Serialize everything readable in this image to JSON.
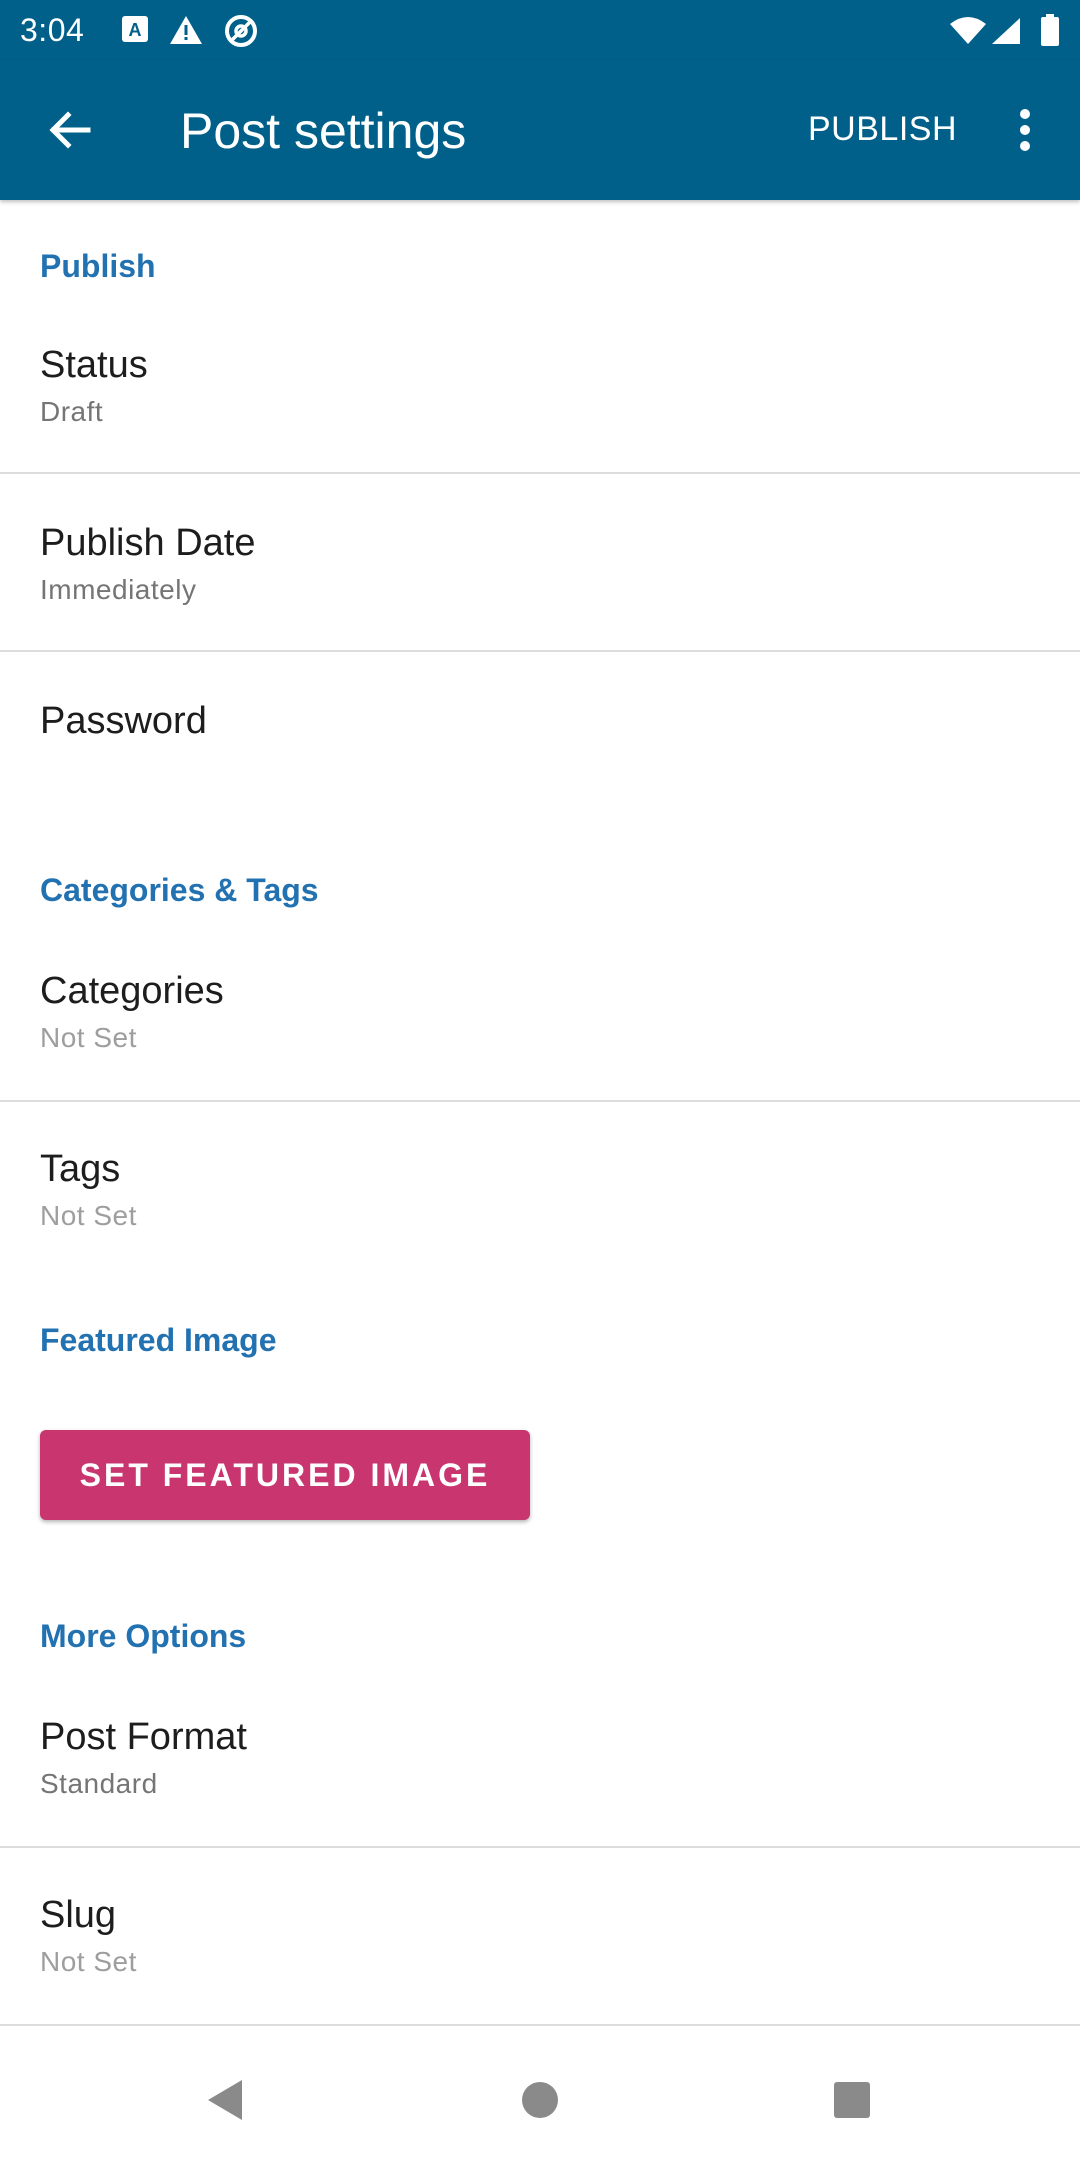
{
  "status_bar": {
    "time": "3:04",
    "icons": [
      "keyboard-a-icon",
      "warning-icon",
      "at-sign-icon",
      "wifi-icon",
      "signal-icon",
      "battery-icon"
    ]
  },
  "app_bar": {
    "title": "Post settings",
    "publish_label": "PUBLISH",
    "back_icon": "arrow-back-icon",
    "more_icon": "more-vertical-icon",
    "background": "#00608a"
  },
  "sections": {
    "publish": {
      "header": "Publish",
      "status": {
        "label": "Status",
        "value": "Draft"
      },
      "publish_date": {
        "label": "Publish Date",
        "value": "Immediately"
      },
      "password": {
        "label": "Password"
      }
    },
    "categories_tags": {
      "header": "Categories & Tags",
      "categories": {
        "label": "Categories",
        "value": "Not Set"
      },
      "tags": {
        "label": "Tags",
        "value": "Not Set"
      }
    },
    "featured_image": {
      "header": "Featured Image",
      "button_label": "SET FEATURED IMAGE",
      "button_color": "#c9356e"
    },
    "more_options": {
      "header": "More Options",
      "post_format": {
        "label": "Post Format",
        "value": "Standard"
      },
      "slug": {
        "label": "Slug",
        "value": "Not Set"
      }
    }
  },
  "accent_color": "#2271b1",
  "nav_bar": {
    "icons": [
      "back-triangle-icon",
      "home-circle-icon",
      "recents-square-icon"
    ]
  }
}
